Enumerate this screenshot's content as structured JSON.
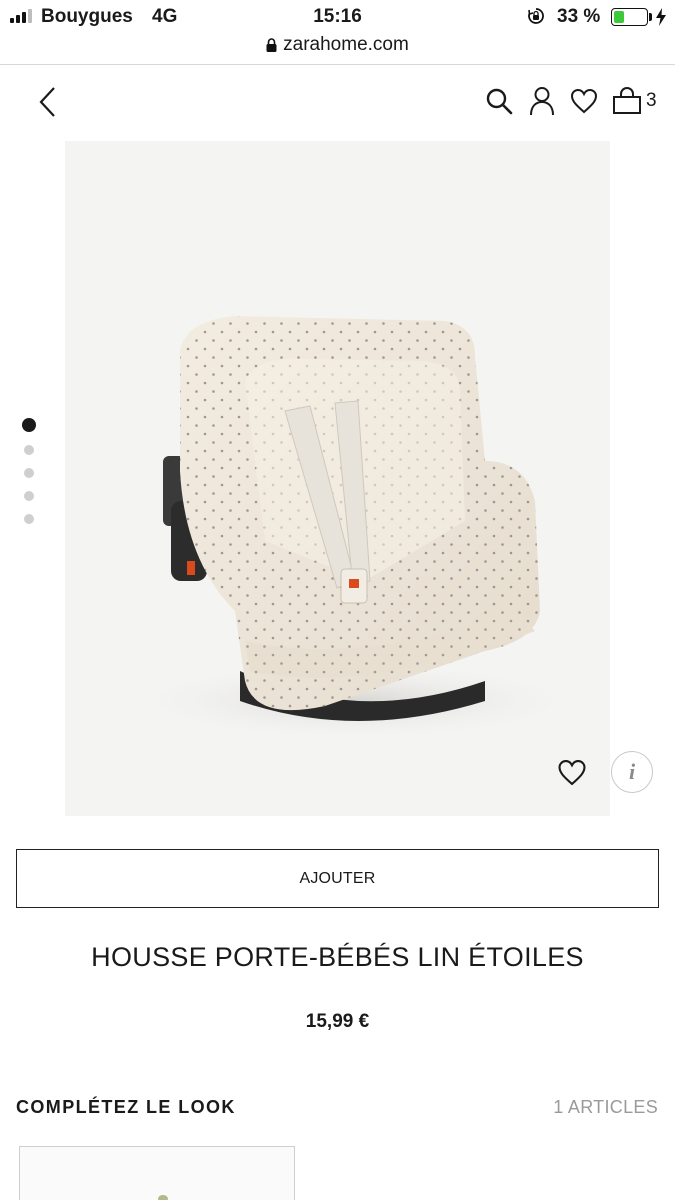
{
  "status_bar": {
    "carrier": "Bouygues",
    "network": "4G",
    "time": "15:16",
    "battery_percent": "33 %",
    "battery_level": 0.33,
    "battery_color": "#3ec93a"
  },
  "browser": {
    "url": "zarahome.com"
  },
  "header": {
    "back_icon": "chevron-left-icon",
    "icons": [
      "search-icon",
      "user-icon",
      "heart-icon",
      "shopping-bag-icon"
    ],
    "cart_count": "3"
  },
  "gallery": {
    "image_description_icon": "baby-car-seat-cover-image",
    "slides_total": 5,
    "active_slide": 1,
    "info_label": "i"
  },
  "product": {
    "add_label": "AJOUTER",
    "title": "HOUSSE PORTE-BÉBÉS LIN ÉTOILES",
    "price": "15,99 €"
  },
  "complete_look": {
    "title": "COMPLÉTEZ LE LOOK",
    "count": "1 ARTICLES"
  },
  "colors": {
    "accent": "#1a1a1a",
    "fabric": "#efe6d8"
  }
}
